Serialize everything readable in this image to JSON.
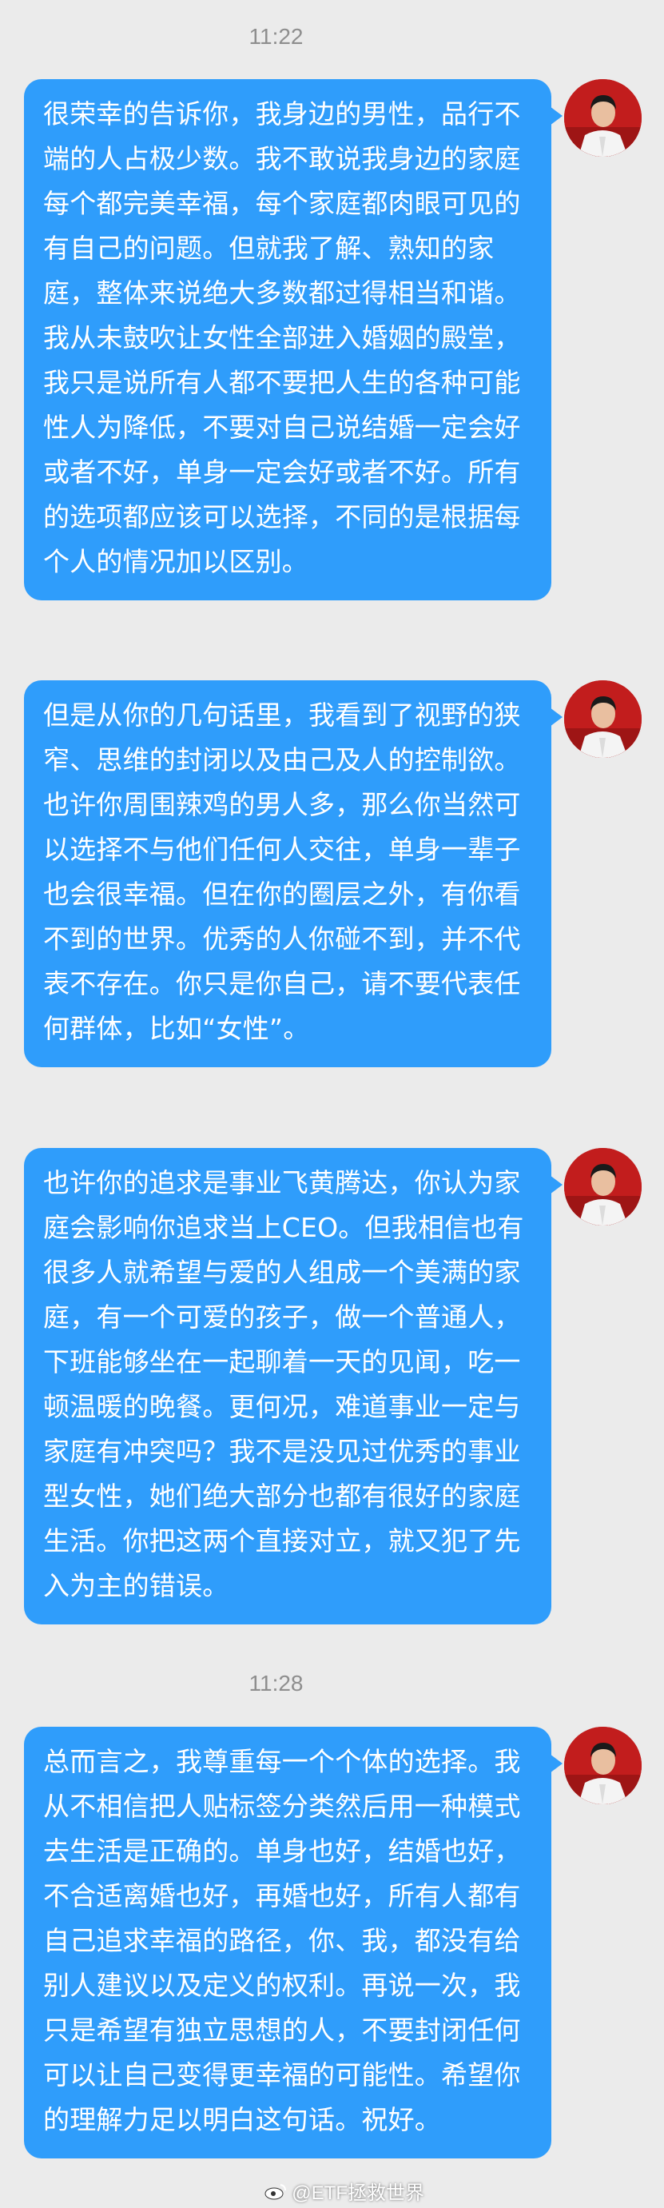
{
  "chat": {
    "timestamps": [
      "11:22",
      "11:28"
    ],
    "messages": [
      {
        "text": "很荣幸的告诉你，我身边的男性，品行不端的人占极少数。我不敢说我身边的家庭每个都完美幸福，每个家庭都肉眼可见的有自己的问题。但就我了解、熟知的家庭，整体来说绝大多数都过得相当和谐。我从未鼓吹让女性全部进入婚姻的殿堂，我只是说所有人都不要把人生的各种可能性人为降低，不要对自己说结婚一定会好或者不好，单身一定会好或者不好。所有的选项都应该可以选择，不同的是根据每个人的情况加以区别。"
      },
      {
        "text": "但是从你的几句话里，我看到了视野的狭窄、思维的封闭以及由己及人的控制欲。也许你周围辣鸡的男人多，那么你当然可以选择不与他们任何人交往，单身一辈子也会很幸福。但在你的圈层之外，有你看不到的世界。优秀的人你碰不到，并不代表不存在。你只是你自己，请不要代表任何群体，比如“女性”。"
      },
      {
        "text": "也许你的追求是事业飞黄腾达，你认为家庭会影响你追求当上CEO。但我相信也有很多人就希望与爱的人组成一个美满的家庭，有一个可爱的孩子，做一个普通人，下班能够坐在一起聊着一天的见闻，吃一顿温暖的晚餐。更何况，难道事业一定与家庭有冲突吗？我不是没见过优秀的事业型女性，她们绝大部分也都有很好的家庭生活。你把这两个直接对立，就又犯了先入为主的错误。"
      },
      {
        "text": "总而言之，我尊重每一个个体的选择。我从不相信把人贴标签分类然后用一种模式去生活是正确的。单身也好，结婚也好，不合适离婚也好，再婚也好，所有人都有自己追求幸福的路径，你、我，都没有给别人建议以及定义的权利。再说一次，我只是希望有独立思想的人，不要封闭任何可以让自己变得更幸福的可能性。希望你的理解力足以明白这句话。祝好。"
      }
    ]
  },
  "watermark": {
    "text": "@ETF拯救世界",
    "icon": "weibo-logo-icon"
  },
  "colors": {
    "background": "#ebebeb",
    "bubble": "#2f9dfb",
    "bubble_text": "#ffffff",
    "timestamp": "#8e8e8e",
    "avatar_bg": "#c21d1d"
  }
}
